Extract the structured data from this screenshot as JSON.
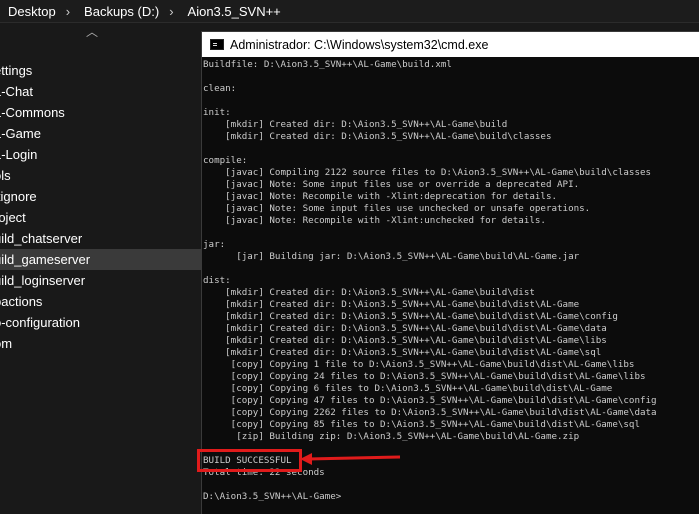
{
  "breadcrumb": [
    "Desktop",
    "Backups (D:)",
    "Aion3.5_SVN++"
  ],
  "nav_items": [
    {
      "label": "ettings",
      "selected": false
    },
    {
      "label": "L-Chat",
      "selected": false
    },
    {
      "label": "L-Commons",
      "selected": false
    },
    {
      "label": "L-Game",
      "selected": false
    },
    {
      "label": "L-Login",
      "selected": false
    },
    {
      "label": "ols",
      "selected": false
    },
    {
      "label": "itignore",
      "selected": false
    },
    {
      "label": "roject",
      "selected": false
    },
    {
      "label": "uild_chatserver",
      "selected": false
    },
    {
      "label": "uild_gameserver",
      "selected": true
    },
    {
      "label": "uild_loginserver",
      "selected": false
    },
    {
      "label": "pactions",
      "selected": false
    },
    {
      "label": "o-configuration",
      "selected": false
    },
    {
      "label": "om",
      "selected": false
    }
  ],
  "cmd_window": {
    "title": "Administrador: C:\\Windows\\system32\\cmd.exe",
    "icon": "cmd-window-icon",
    "lines": [
      "Buildfile: D:\\Aion3.5_SVN++\\AL-Game\\build.xml",
      "",
      "clean:",
      "",
      "init:",
      "    [mkdir] Created dir: D:\\Aion3.5_SVN++\\AL-Game\\build",
      "    [mkdir] Created dir: D:\\Aion3.5_SVN++\\AL-Game\\build\\classes",
      "",
      "compile:",
      "    [javac] Compiling 2122 source files to D:\\Aion3.5_SVN++\\AL-Game\\build\\classes",
      "    [javac] Note: Some input files use or override a deprecated API.",
      "    [javac] Note: Recompile with -Xlint:deprecation for details.",
      "    [javac] Note: Some input files use unchecked or unsafe operations.",
      "    [javac] Note: Recompile with -Xlint:unchecked for details.",
      "",
      "jar:",
      "      [jar] Building jar: D:\\Aion3.5_SVN++\\AL-Game\\build\\AL-Game.jar",
      "",
      "dist:",
      "    [mkdir] Created dir: D:\\Aion3.5_SVN++\\AL-Game\\build\\dist",
      "    [mkdir] Created dir: D:\\Aion3.5_SVN++\\AL-Game\\build\\dist\\AL-Game",
      "    [mkdir] Created dir: D:\\Aion3.5_SVN++\\AL-Game\\build\\dist\\AL-Game\\config",
      "    [mkdir] Created dir: D:\\Aion3.5_SVN++\\AL-Game\\build\\dist\\AL-Game\\data",
      "    [mkdir] Created dir: D:\\Aion3.5_SVN++\\AL-Game\\build\\dist\\AL-Game\\libs",
      "    [mkdir] Created dir: D:\\Aion3.5_SVN++\\AL-Game\\build\\dist\\AL-Game\\sql",
      "     [copy] Copying 1 file to D:\\Aion3.5_SVN++\\AL-Game\\build\\dist\\AL-Game\\libs",
      "     [copy] Copying 24 files to D:\\Aion3.5_SVN++\\AL-Game\\build\\dist\\AL-Game\\libs",
      "     [copy] Copying 6 files to D:\\Aion3.5_SVN++\\AL-Game\\build\\dist\\AL-Game",
      "     [copy] Copying 47 files to D:\\Aion3.5_SVN++\\AL-Game\\build\\dist\\AL-Game\\config",
      "     [copy] Copying 2262 files to D:\\Aion3.5_SVN++\\AL-Game\\build\\dist\\AL-Game\\data",
      "     [copy] Copying 85 files to D:\\Aion3.5_SVN++\\AL-Game\\build\\dist\\AL-Game\\sql",
      "      [zip] Building zip: D:\\Aion3.5_SVN++\\AL-Game\\build\\AL-Game.zip",
      "",
      "BUILD SUCCESSFUL",
      "Total time: 22 seconds",
      "",
      "D:\\Aion3.5_SVN++\\AL-Game>"
    ]
  },
  "annotation": {
    "color": "#e01b1b",
    "target": "BUILD SUCCESSFUL"
  },
  "colors": {
    "console_bg": "#0c0c0c",
    "console_text": "#cccccc",
    "explorer_bg": "#191919",
    "selected_row": "#3a3a3a"
  }
}
